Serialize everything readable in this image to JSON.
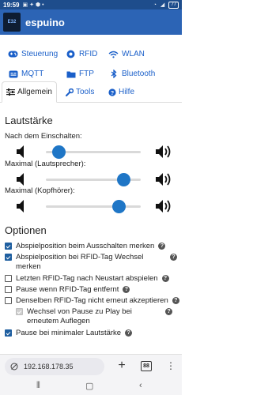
{
  "status": {
    "time": "19:59",
    "battery": "77"
  },
  "app": {
    "title": "espuino",
    "logo_text": "E32"
  },
  "nav": {
    "row1": [
      {
        "label": "Steuerung",
        "icon": "controller-icon"
      },
      {
        "label": "RFID",
        "icon": "rfid-icon"
      },
      {
        "label": "WLAN",
        "icon": "wifi-icon"
      }
    ],
    "row2": [
      {
        "label": "MQTT",
        "icon": "mqtt-icon"
      },
      {
        "label": "FTP",
        "icon": "folder-icon"
      },
      {
        "label": "Bluetooth",
        "icon": "bluetooth-icon"
      }
    ]
  },
  "tabs": [
    {
      "label": "Allgemein",
      "active": true
    },
    {
      "label": "Tools",
      "active": false
    },
    {
      "label": "Hilfe",
      "active": false
    }
  ],
  "volume": {
    "heading": "Lautstärke",
    "sliders": [
      {
        "label": "Nach dem Einschalten:",
        "level": 0.13
      },
      {
        "label": "Maximal (Lautsprecher):",
        "level": 0.82
      },
      {
        "label": "Maximal (Kopfhörer):",
        "level": 0.77
      }
    ]
  },
  "options": {
    "heading": "Optionen",
    "items": [
      {
        "text": "Abspielposition beim Ausschalten merken",
        "checked": true,
        "help": true
      },
      {
        "text": "Abspielposition bei RFID-Tag Wechsel merken",
        "checked": true,
        "help": true
      },
      {
        "text": "Letzten RFID-Tag nach Neustart abspielen",
        "checked": false,
        "help": true
      },
      {
        "text": "Pause wenn RFID-Tag entfernt",
        "checked": false,
        "help": true
      },
      {
        "text": "Denselben RFID-Tag nicht erneut akzeptieren",
        "checked": false,
        "help": true
      },
      {
        "text": "Wechsel von Pause zu Play bei erneutem Auflegen",
        "checked": true,
        "disabled": true,
        "help": true
      },
      {
        "text": "Pause bei minimaler Lautstärke",
        "checked": true,
        "help": true
      }
    ]
  },
  "browser": {
    "url": "192.168.178.35",
    "tab_count": "88"
  },
  "colors": {
    "header": "#2c64b5",
    "status_bar": "#1e4d8c",
    "link": "#1a5fc9",
    "slider_thumb": "#1f76c6",
    "checkbox": "#1f5fa0"
  }
}
